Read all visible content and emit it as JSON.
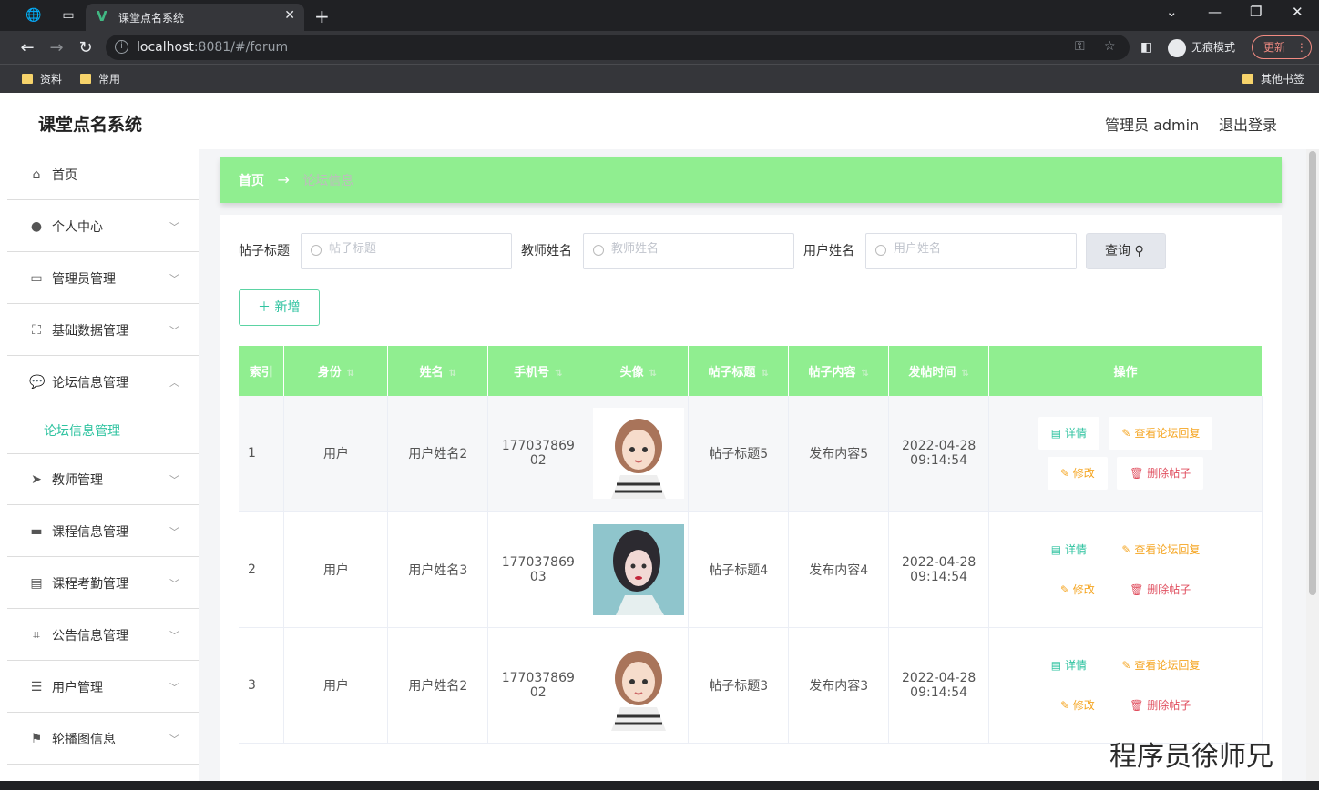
{
  "browser": {
    "tab_title": "课堂点名系统",
    "url_host": "localhost",
    "url_rest": ":8081/#/forum",
    "incognito_label": "无痕模式",
    "update_label": "更新",
    "bookmarks": [
      "资料",
      "常用"
    ],
    "other_bookmarks": "其他书签"
  },
  "app": {
    "title": "课堂点名系统",
    "admin_text": "管理员 admin",
    "logout": "退出登录"
  },
  "sidebar": {
    "items": [
      {
        "label": "首页",
        "icon": "home-icon"
      },
      {
        "label": "个人中心",
        "icon": "user-icon"
      },
      {
        "label": "管理员管理",
        "icon": "id-card-icon"
      },
      {
        "label": "基础数据管理",
        "icon": "fullscreen-icon"
      },
      {
        "label": "论坛信息管理",
        "icon": "chat-icon"
      },
      {
        "label": "教师管理",
        "icon": "send-icon"
      },
      {
        "label": "课程信息管理",
        "icon": "briefcase-icon"
      },
      {
        "label": "课程考勤管理",
        "icon": "clipboard-icon"
      },
      {
        "label": "公告信息管理",
        "icon": "crop-icon"
      },
      {
        "label": "用户管理",
        "icon": "list-icon"
      },
      {
        "label": "轮播图信息",
        "icon": "flag-icon"
      }
    ],
    "sub_item": "论坛信息管理"
  },
  "breadcrumb": {
    "home": "首页",
    "current": "论坛信息"
  },
  "search": {
    "title_label": "帖子标题",
    "title_placeholder": "帖子标题",
    "teacher_label": "教师姓名",
    "teacher_placeholder": "教师姓名",
    "user_label": "用户姓名",
    "user_placeholder": "用户姓名",
    "query_button": "查询"
  },
  "add_button": "新增",
  "table": {
    "headers": [
      "索引",
      "身份",
      "姓名",
      "手机号",
      "头像",
      "帖子标题",
      "帖子内容",
      "发帖时间",
      "操作"
    ],
    "rows": [
      {
        "index": "1",
        "role": "用户",
        "name": "用户姓名2",
        "phone": "17703786902",
        "avatar": "cartoon",
        "title": "帖子标题5",
        "content": "发布内容5",
        "date": "2022-04-28",
        "time": "09:14:54"
      },
      {
        "index": "2",
        "role": "用户",
        "name": "用户姓名3",
        "phone": "17703786903",
        "avatar": "photo",
        "title": "帖子标题4",
        "content": "发布内容4",
        "date": "2022-04-28",
        "time": "09:14:54"
      },
      {
        "index": "3",
        "role": "用户",
        "name": "用户姓名2",
        "phone": "17703786902",
        "avatar": "cartoon",
        "title": "帖子标题3",
        "content": "发布内容3",
        "date": "2022-04-28",
        "time": "09:14:54"
      }
    ],
    "actions": {
      "detail": "详情",
      "view_replies": "查看论坛回复",
      "edit": "修改",
      "delete": "删除帖子"
    }
  },
  "watermark": "程序员徐师兄",
  "colors": {
    "accent_green": "#90ee90",
    "teal": "#2fc3a0",
    "orange": "#f5a623",
    "red": "#e04f5f"
  }
}
